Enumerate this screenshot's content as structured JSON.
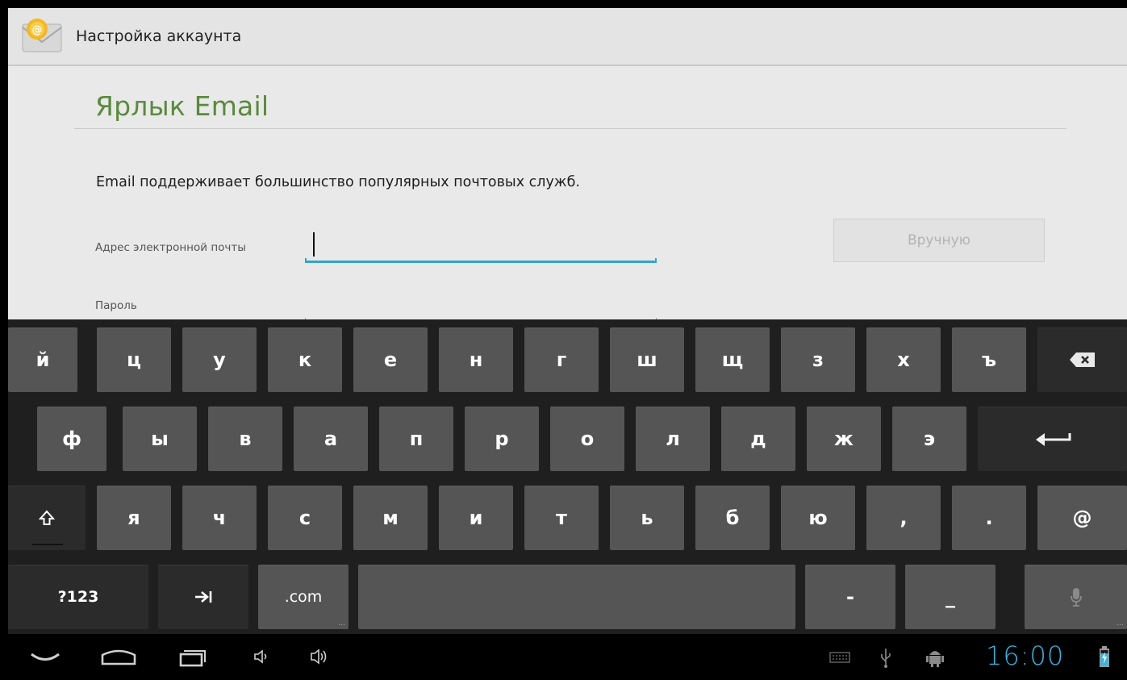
{
  "app_bar": {
    "title": "Настройка аккаунта",
    "icon": "email-envelope-icon"
  },
  "setup": {
    "heading": "Ярлык Email",
    "intro": "Email поддерживает большинство популярных почтовых служб.",
    "email_label": "Адрес электронной почты",
    "email_value": "",
    "password_label": "Пароль",
    "manual_button": "Вручную",
    "accent_color": "#33a4c9",
    "heading_color": "#5a8a3c"
  },
  "keyboard": {
    "row1": [
      "й",
      "ц",
      "у",
      "к",
      "е",
      "н",
      "г",
      "ш",
      "щ",
      "з",
      "х",
      "ъ"
    ],
    "row2": [
      "ф",
      "ы",
      "в",
      "а",
      "п",
      "р",
      "о",
      "л",
      "д",
      "ж",
      "э"
    ],
    "row3": [
      "я",
      "ч",
      "с",
      "м",
      "и",
      "т",
      "ь",
      "б",
      "ю",
      ",",
      ".",
      "@"
    ],
    "row4": {
      "symbols": "?123",
      "dotcom": ".com",
      "dash": "-",
      "underscore": "_"
    },
    "icons": {
      "backspace": "backspace-icon",
      "enter": "enter-icon",
      "shift": "shift-icon",
      "tab": "tab-icon",
      "mic": "mic-icon"
    }
  },
  "system_bar": {
    "time": "16:00",
    "clock_color": "#33b5e5",
    "icons": [
      "back-icon",
      "home-icon",
      "recents-icon",
      "volume-down-icon",
      "volume-up-icon",
      "keyboard-icon",
      "usb-icon",
      "android-debug-icon",
      "battery-icon"
    ]
  }
}
